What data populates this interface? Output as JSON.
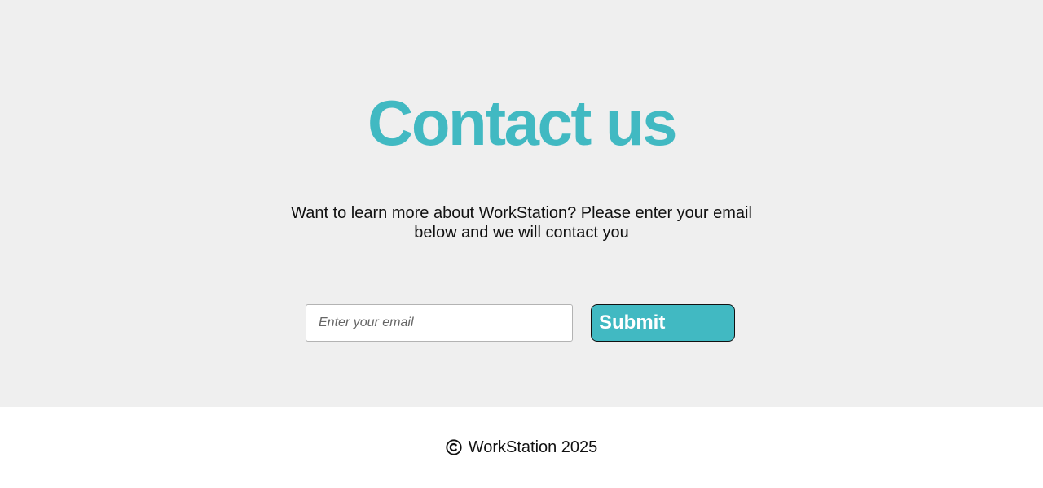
{
  "contact": {
    "title": "Contact us",
    "description": "Want to learn more about WorkStation? Please enter your email below and we will contact you",
    "email_placeholder": "Enter your email",
    "email_value": "",
    "submit_label": "Submit"
  },
  "footer": {
    "copyright_icon": "copyright-icon",
    "text": "WorkStation 2025"
  },
  "colors": {
    "accent": "#41b9c2",
    "section_background": "#efefef",
    "footer_background": "#ffffff"
  }
}
